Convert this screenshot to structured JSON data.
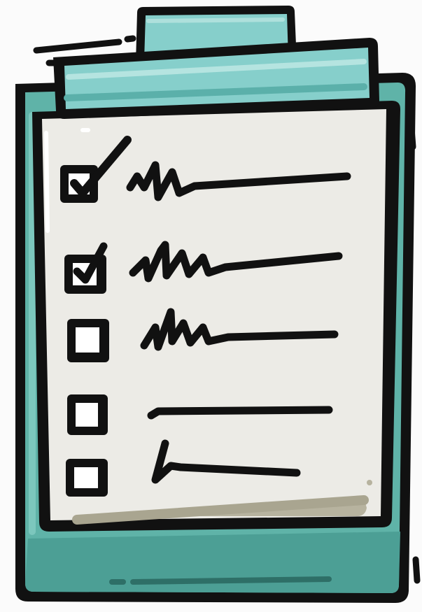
{
  "illustration": {
    "subject": "clipboard-checklist",
    "colors": {
      "board": "#5fb3a8",
      "board_shadow": "#3f8e84",
      "clip": "#86cfcb",
      "paper": "#ecebe6",
      "paper_shadow": "#b7b39f",
      "ink": "#111111",
      "checkbox": "#ffffff",
      "background": "#fbfbfb"
    },
    "checklist": {
      "items": [
        {
          "checked": true,
          "icon": "checkbox-checked-icon",
          "line": "scribble-line"
        },
        {
          "checked": true,
          "icon": "checkbox-checked-icon",
          "line": "scribble-line"
        },
        {
          "checked": false,
          "icon": "checkbox-empty-icon",
          "line": "scribble-line"
        },
        {
          "checked": false,
          "icon": "checkbox-empty-icon",
          "line": "straight-line"
        },
        {
          "checked": false,
          "icon": "checkbox-empty-icon",
          "line": "hook-line"
        }
      ]
    }
  }
}
